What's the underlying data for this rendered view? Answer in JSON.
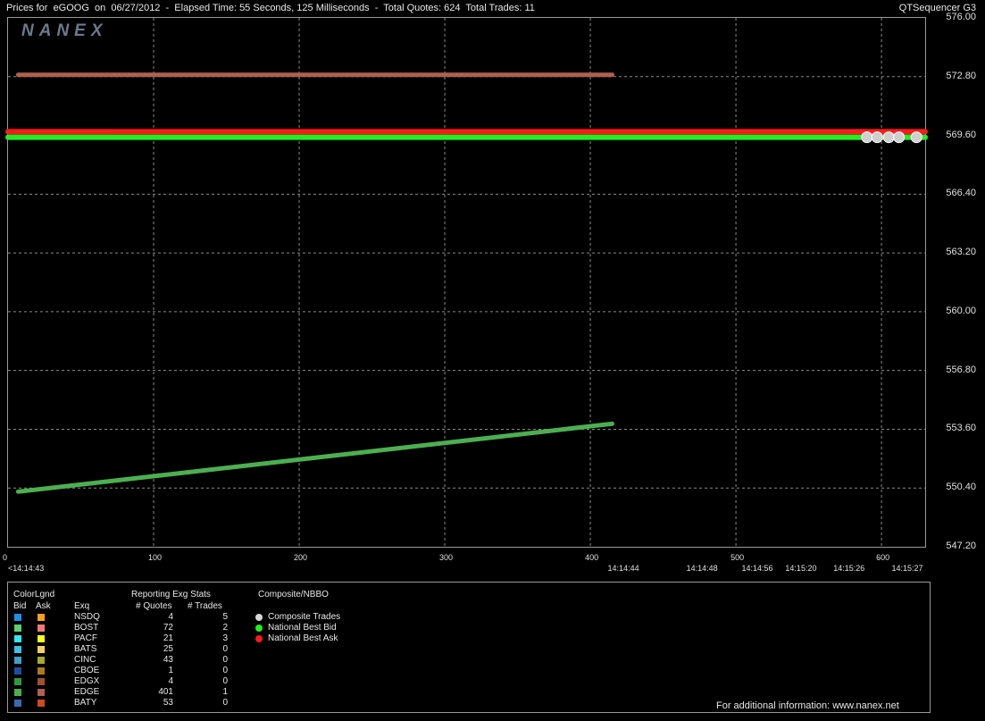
{
  "header": {
    "title": "Prices for  eGOOG  on  06/27/2012  -  Elapsed Time: 55 Seconds, 125 Milliseconds  -  Total Quotes: 624  Total Trades: 11",
    "app_name": "QTSequencer G3"
  },
  "watermark": "NANEX",
  "chart_data": {
    "type": "scatter",
    "y_ticks": [
      "576.00",
      "572.80",
      "569.60",
      "566.40",
      "563.20",
      "560.00",
      "556.80",
      "553.60",
      "550.40",
      "547.20"
    ],
    "ylim": [
      547.2,
      576.0
    ],
    "xlim": [
      0,
      630
    ],
    "x_ticks": [
      "0",
      "100",
      "200",
      "300",
      "400",
      "500",
      "600"
    ],
    "time_ticks": [
      {
        "label": "<14:14:43",
        "x": 0
      },
      {
        "label": "14:14:44",
        "x": 423
      },
      {
        "label": "14:14:48",
        "x": 477
      },
      {
        "label": "14:14:56",
        "x": 515
      },
      {
        "label": "14:15:20",
        "x": 545
      },
      {
        "label": "14:15:26",
        "x": 578
      },
      {
        "label": "14:15:27",
        "x": 618
      }
    ],
    "grid": true,
    "series": [
      {
        "name": "National Best Ask",
        "color": "#ff1a1a",
        "points": [
          [
            0,
            569.8
          ],
          [
            423,
            569.8
          ],
          [
            630,
            569.8
          ]
        ]
      },
      {
        "name": "National Best Bid",
        "color": "#22ee22",
        "points": [
          [
            0,
            569.5
          ],
          [
            423,
            569.5
          ],
          [
            630,
            569.5
          ]
        ]
      },
      {
        "name": "EDGE bid",
        "color": "#4caf50",
        "points": [
          [
            7,
            550.2
          ],
          [
            415,
            553.9
          ]
        ]
      },
      {
        "name": "EDGE ask",
        "color": "#b06050",
        "points": [
          [
            7,
            572.9
          ],
          [
            415,
            572.9
          ]
        ]
      }
    ],
    "trades": [
      [
        590,
        569.5
      ],
      [
        597,
        569.5
      ],
      [
        605,
        569.5
      ],
      [
        612,
        569.5
      ],
      [
        624,
        569.5
      ]
    ]
  },
  "legend": {
    "colorlgnd": "ColorLgnd",
    "bid": "Bid",
    "ask": "Ask",
    "stats_title": "Reporting Exg Stats",
    "composite_title": "Composite/NBBO",
    "exq": "Exq",
    "quotes": "# Quotes",
    "trades": "# Trades",
    "rows": [
      {
        "exq": "NSDQ",
        "quotes": "4",
        "trades": "5",
        "bid": "#1e8fe8",
        "ask": "#ff9f1a"
      },
      {
        "exq": "BOST",
        "quotes": "72",
        "trades": "2",
        "bid": "#5ecf6e",
        "ask": "#f07a7a"
      },
      {
        "exq": "PACF",
        "quotes": "21",
        "trades": "3",
        "bid": "#33e8f0",
        "ask": "#ffff1a"
      },
      {
        "exq": "BATS",
        "quotes": "25",
        "trades": "0",
        "bid": "#3cbfe8",
        "ask": "#f5d060"
      },
      {
        "exq": "CINC",
        "quotes": "43",
        "trades": "0",
        "bid": "#3ca0c8",
        "ask": "#a8a82a"
      },
      {
        "exq": "CBOE",
        "quotes": "1",
        "trades": "0",
        "bid": "#1d4fa0",
        "ask": "#b07a1a"
      },
      {
        "exq": "EDGX",
        "quotes": "4",
        "trades": "0",
        "bid": "#2e9a3e",
        "ask": "#a0502e"
      },
      {
        "exq": "EDGE",
        "quotes": "401",
        "trades": "1",
        "bid": "#4caf50",
        "ask": "#b06050"
      },
      {
        "exq": "BATY",
        "quotes": "53",
        "trades": "0",
        "bid": "#3a6ab0",
        "ask": "#d04a1a"
      }
    ],
    "composite": [
      {
        "label": "Composite Trades",
        "color": "#d8d8d8"
      },
      {
        "label": "National Best Bid",
        "color": "#22ee22"
      },
      {
        "label": "National Best Ask",
        "color": "#ff1a1a"
      }
    ],
    "footer": "For additional information: www.nanex.net"
  }
}
